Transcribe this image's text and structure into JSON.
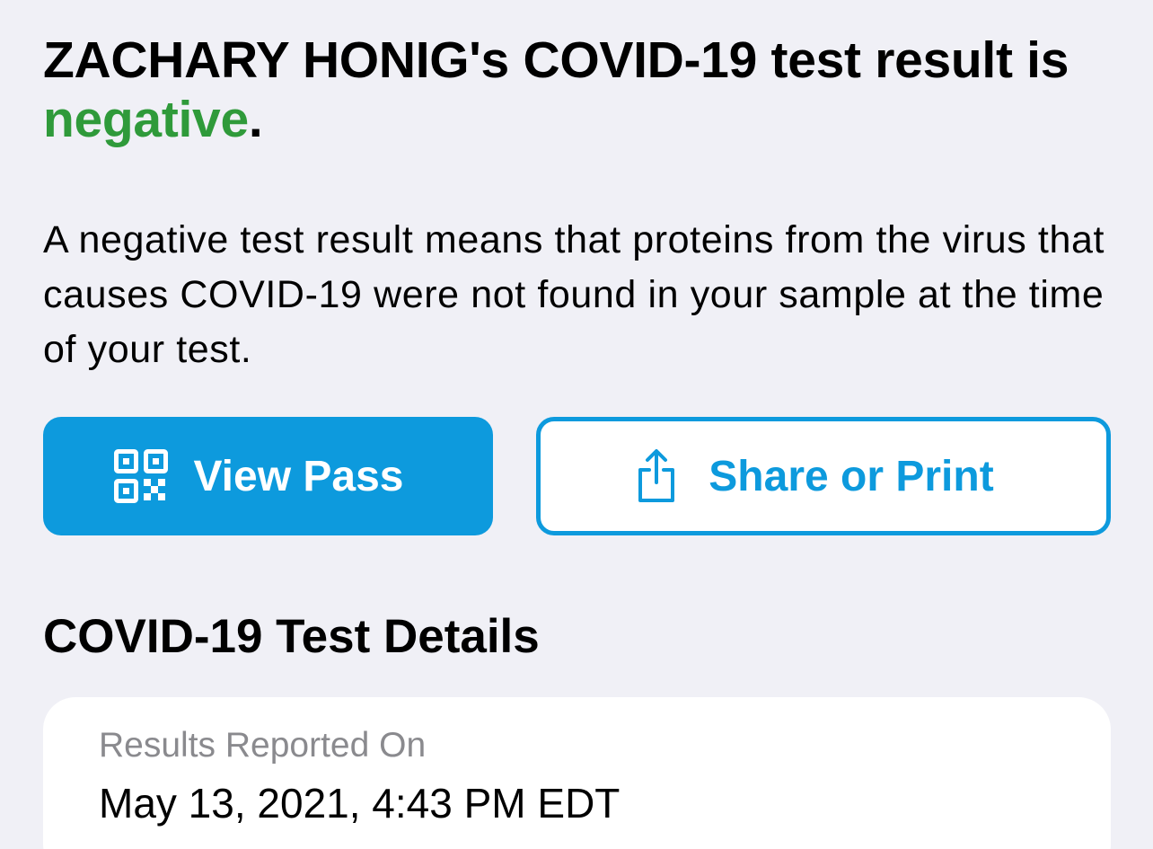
{
  "headline": {
    "prefix": "ZACHARY HONIG's COVID-19 test result is ",
    "result": "negative",
    "suffix": "."
  },
  "description": "A negative test result means that proteins from the virus that causes COVID-19 were not found in your sample at the time of your test.",
  "buttons": {
    "view_pass": {
      "label": "View Pass",
      "icon": "qr-code-icon"
    },
    "share": {
      "label": "Share or Print",
      "icon": "share-icon"
    }
  },
  "details": {
    "title": "COVID-19 Test Details",
    "results_reported_label": "Results Reported On",
    "results_reported_value": "May 13, 2021, 4:43 PM EDT"
  },
  "colors": {
    "accent": "#0d9add",
    "negative": "#2f9a3a",
    "background": "#f0f0f6",
    "secondary_text": "#8a8a8e"
  }
}
